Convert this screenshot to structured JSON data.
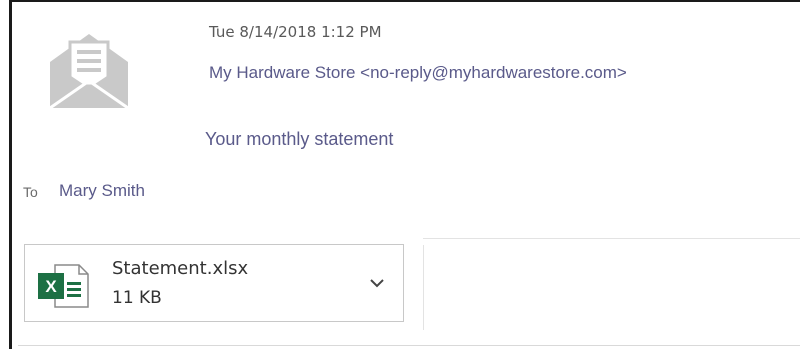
{
  "message": {
    "date": "Tue 8/14/2018 1:12 PM",
    "from": "My Hardware Store <no-reply@myhardwarestore.com>",
    "subject": "Your monthly statement",
    "to_label": "To",
    "to": "Mary Smith"
  },
  "attachment": {
    "filename": "Statement.xlsx",
    "size": "11 KB",
    "file_type_icon": "excel-icon",
    "excel_badge": "X",
    "menu_icon": "chevron-down-icon"
  },
  "icons": {
    "sender_avatar": "envelope-letter-icon"
  },
  "colors": {
    "excel_green": "#1d7044",
    "avatar_gray": "#c9c9c9",
    "link_text": "#5a5a8a"
  }
}
